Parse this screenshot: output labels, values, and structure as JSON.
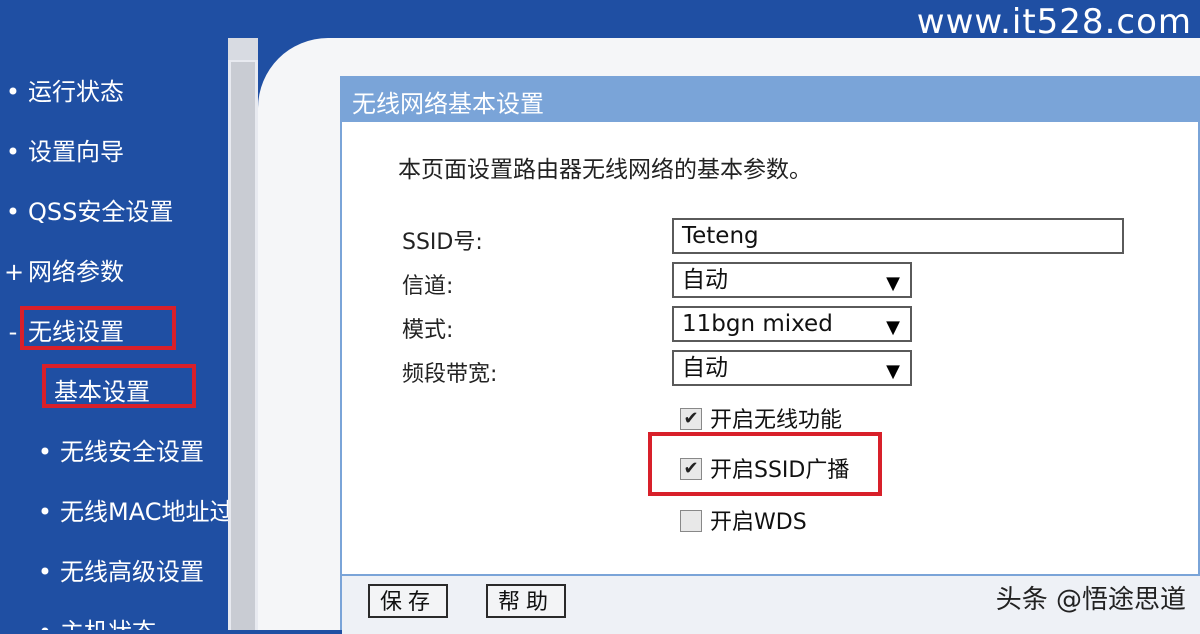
{
  "header": {
    "site_url": "www.it528.com"
  },
  "sidebar": {
    "items": [
      {
        "label": "运行状态",
        "bullet": "•"
      },
      {
        "label": "设置向导",
        "bullet": "•"
      },
      {
        "label": "QSS安全设置",
        "bullet": "•"
      },
      {
        "label": "网络参数",
        "bullet": "+"
      },
      {
        "label": "无线设置",
        "bullet": "-"
      }
    ],
    "subitems": [
      {
        "label": "基本设置"
      },
      {
        "label": "无线安全设置"
      },
      {
        "label": "无线MAC地址过滤"
      },
      {
        "label": "无线高级设置"
      },
      {
        "label": "主机状态"
      }
    ]
  },
  "panel": {
    "title": "无线网络基本设置",
    "description": "本页面设置路由器无线网络的基本参数。",
    "fields": {
      "ssid_label": "SSID号:",
      "ssid_value": "Teteng",
      "channel_label": "信道:",
      "channel_value": "自动",
      "mode_label": "模式:",
      "mode_value": "11bgn mixed",
      "bandwidth_label": "频段带宽:",
      "bandwidth_value": "自动"
    },
    "checkboxes": {
      "wireless_label": "开启无线功能",
      "wireless_checked": true,
      "ssid_broadcast_label": "开启SSID广播",
      "ssid_broadcast_checked": true,
      "wds_label": "开启WDS",
      "wds_checked": false
    },
    "buttons": {
      "save": "保存",
      "help": "帮助"
    }
  },
  "watermark": {
    "text": "头条 @悟途思道"
  },
  "colors": {
    "nav_bg": "#1f4fa3",
    "panel_header": "#7aa4d8",
    "highlight": "#d8202a"
  }
}
